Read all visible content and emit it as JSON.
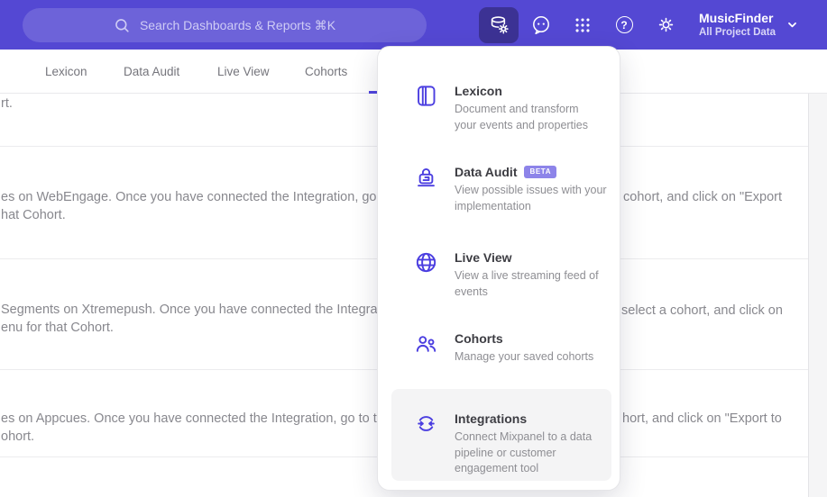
{
  "topbar": {
    "search": {
      "placeholder": "Search Dashboards & Reports ⌘K"
    },
    "project": {
      "name": "MusicFinder",
      "scope": "All Project Data"
    },
    "help_glyph": "?"
  },
  "tabs": {
    "items": [
      {
        "label": "Lexicon"
      },
      {
        "label": "Data Audit"
      },
      {
        "label": "Live View"
      },
      {
        "label": "Cohorts"
      }
    ]
  },
  "menu": {
    "items": [
      {
        "title": "Lexicon",
        "desc": "Document and transform\nyour events and properties"
      },
      {
        "title": "Data Audit",
        "badge": "BETA",
        "desc": "View possible issues with your\nimplementation"
      },
      {
        "title": "Live View",
        "desc": "View a live streaming feed of\nevents"
      },
      {
        "title": "Cohorts",
        "desc": "Manage your saved cohorts"
      },
      {
        "title": "Integrations",
        "desc": "Connect Mixpanel to a data\npipeline or customer\nengagement tool"
      }
    ]
  },
  "background": {
    "fragments": [
      {
        "text": "rt."
      },
      {
        "text": "es on WebEngage. Once you have connected the Integration, go to the"
      },
      {
        "text": "cohort, and click on \"Export"
      },
      {
        "text": "hat Cohort."
      },
      {
        "text": "Segments on Xtremepush. Once you have connected the Integration,"
      },
      {
        "text": "select a cohort, and click on"
      },
      {
        "text": "enu for that Cohort."
      },
      {
        "text": "es on Appcues. Once you have connected the Integration, go to the M"
      },
      {
        "text": "hort, and click on \"Export to"
      },
      {
        "text": "ohort."
      }
    ]
  },
  "colors": {
    "topbar_purple": "#5448d3",
    "active_button_bg": "#3c3294",
    "menu_icon_purple": "#4b3ee0",
    "tab_indicator": "#4f44de",
    "beta_badge_bg": "#8d84e9",
    "highlight_bg": "#f4f4f5"
  }
}
